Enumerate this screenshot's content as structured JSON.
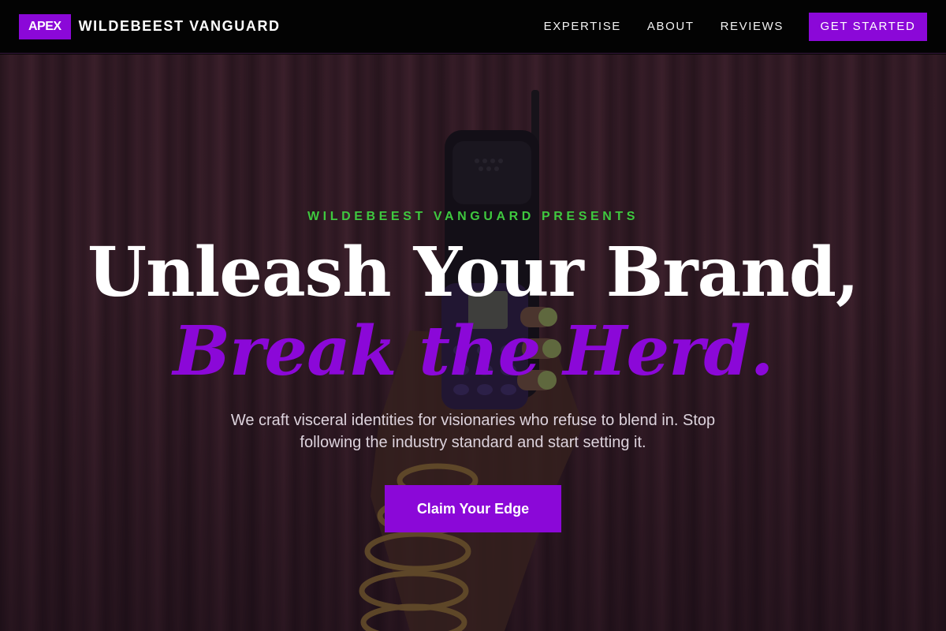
{
  "nav": {
    "logo_badge": "APEX",
    "brand_name": "WILDEBEEST VANGUARD",
    "links": [
      "EXPERTISE",
      "ABOUT",
      "REVIEWS"
    ],
    "cta_label": "GET STARTED"
  },
  "hero": {
    "eyebrow": "WILDEBEEST VANGUARD PRESENTS",
    "headline_line1": "Unleash Your Brand,",
    "headline_line2": "Break the Herd.",
    "subtext": "We craft visceral identities for visionaries who refuse to blend in. Stop following the industry standard and start setting it.",
    "cta_label": "Claim Your Edge"
  },
  "colors": {
    "accent": "#8b08d8",
    "eyebrow_green": "#3fc83f",
    "nav_background": "#030303"
  }
}
